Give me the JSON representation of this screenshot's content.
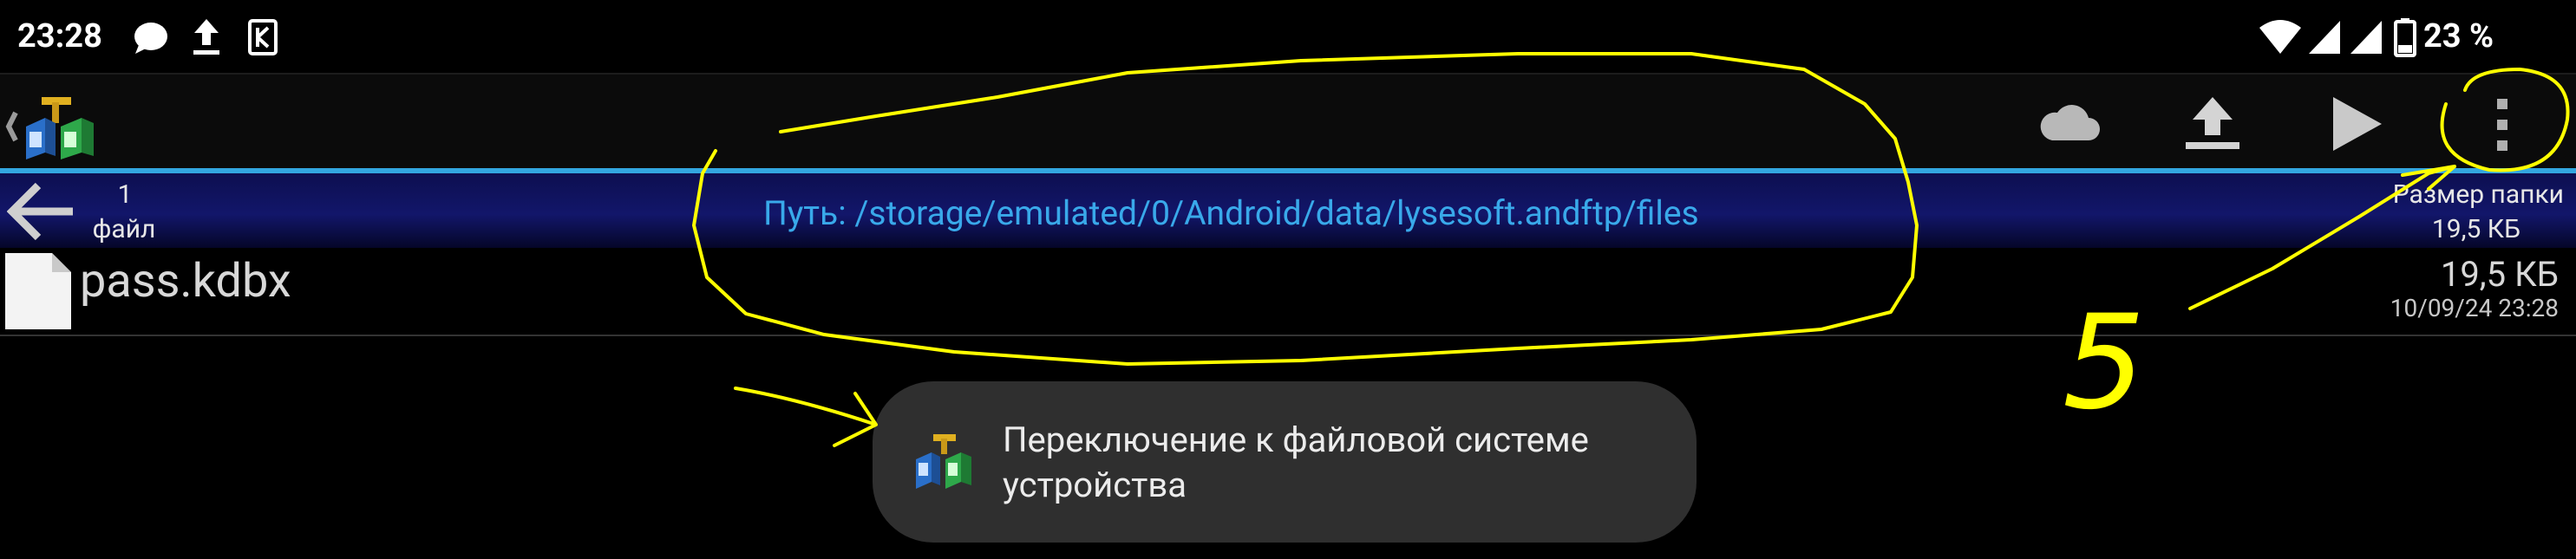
{
  "status_bar": {
    "time": "23:28",
    "battery_percent": "23 %"
  },
  "toolbar": {
    "icons": [
      "app-logo-icon",
      "cloud-icon",
      "upload-icon",
      "play-icon",
      "more-vert-icon"
    ]
  },
  "path_bar": {
    "file_count": "1",
    "file_count_unit": "файл",
    "path": "Путь: /storage/emulated/0/Android/data/lysesoft.andftp/files",
    "folder_size_label": "Размер папки",
    "folder_size_value": "19,5 КБ"
  },
  "files": [
    {
      "name": "pass.kdbx",
      "size": "19,5 КБ",
      "modified": "10/09/24 23:28"
    }
  ],
  "toast": {
    "message": "Переключение к файловой системе устройства"
  },
  "annotation": {
    "label": "5",
    "color": "#ffff00"
  }
}
